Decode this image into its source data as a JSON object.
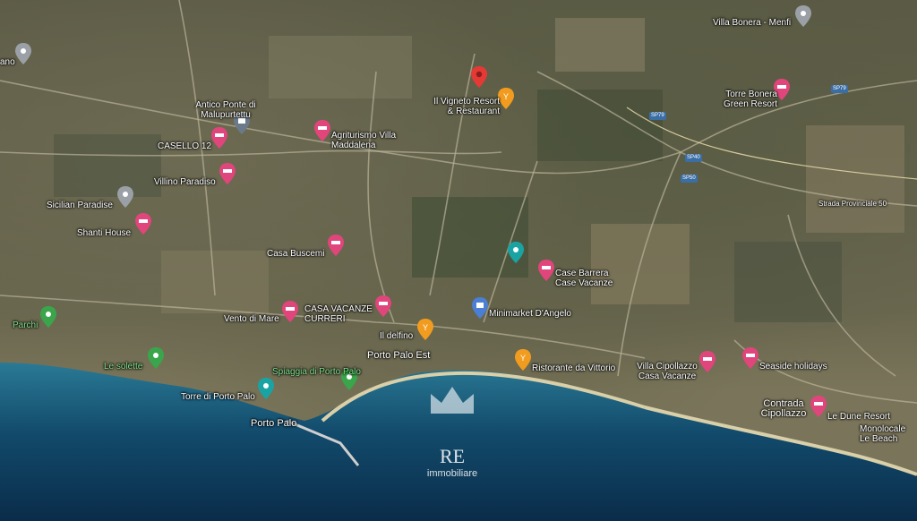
{
  "map": {
    "places": [
      {
        "id": "vigneto",
        "name": "Il Vigneto Resort & Restaurant"
      },
      {
        "id": "villa-bonera",
        "name": "Villa Bonera - Menfi"
      },
      {
        "id": "torre-bonera",
        "name": "Torre Bonera Green Resort"
      },
      {
        "id": "antico-ponte",
        "name": "Antico Ponte di Malupurtettu"
      },
      {
        "id": "agriturismo",
        "name": "Agriturismo Villa Maddalena"
      },
      {
        "id": "casello",
        "name": "CASELLO 12"
      },
      {
        "id": "villino",
        "name": "Villino Paradiso"
      },
      {
        "id": "sicilian",
        "name": "Sicilian Paradise"
      },
      {
        "id": "shanti",
        "name": "Shanti House"
      },
      {
        "id": "casa-buscemi",
        "name": "Casa Buscemi"
      },
      {
        "id": "case-barrera",
        "name": "Case Barrera Case Vacanze"
      },
      {
        "id": "casa-vacanze",
        "name": "CASA VACANZE CURRERI"
      },
      {
        "id": "minimarket",
        "name": "Minimarket D'Angelo"
      },
      {
        "id": "vento",
        "name": "Vento di Mare"
      },
      {
        "id": "parchi",
        "name": "Parchi"
      },
      {
        "id": "ildelfino",
        "name": "Il delfino"
      },
      {
        "id": "porto-palo-est",
        "name": "Porto Palo Est"
      },
      {
        "id": "ristorante",
        "name": "Ristorante da Vittorio"
      },
      {
        "id": "le-solette",
        "name": "Le solette"
      },
      {
        "id": "spiaggia",
        "name": "Spiaggia di Porto Palo"
      },
      {
        "id": "torre-porto-palo",
        "name": "Torre di Porto Palo"
      },
      {
        "id": "porto-palo",
        "name": "Porto Palo"
      },
      {
        "id": "villa-cipollazzo",
        "name": "Villa Cipollazzo Casa Vacanze"
      },
      {
        "id": "seaside",
        "name": "Seaside holidays"
      },
      {
        "id": "contrada",
        "name": "Contrada Cipollazzo"
      },
      {
        "id": "le-dune",
        "name": "Le Dune Resort"
      },
      {
        "id": "monolocale",
        "name": "Monolocale Le Beach"
      },
      {
        "id": "strada",
        "name": "Strada Provinciale 50"
      },
      {
        "id": "ano",
        "name": "ano"
      }
    ],
    "road_badges": [
      "SP79",
      "SP79",
      "SP40",
      "SP50"
    ]
  },
  "watermark": {
    "brand": "RE",
    "subtitle": "immobiliare"
  },
  "colors": {
    "sea_deep": "#0a2c4a",
    "sea_shallow": "#2a7a95",
    "beach": "#d9cfa8",
    "pin_red": "#e53935",
    "pin_pink": "#e0457b",
    "pin_orange": "#f29c1f",
    "pin_blue": "#4a7fd4",
    "pin_teal": "#1aa3a3",
    "pin_green": "#3aa54a"
  }
}
